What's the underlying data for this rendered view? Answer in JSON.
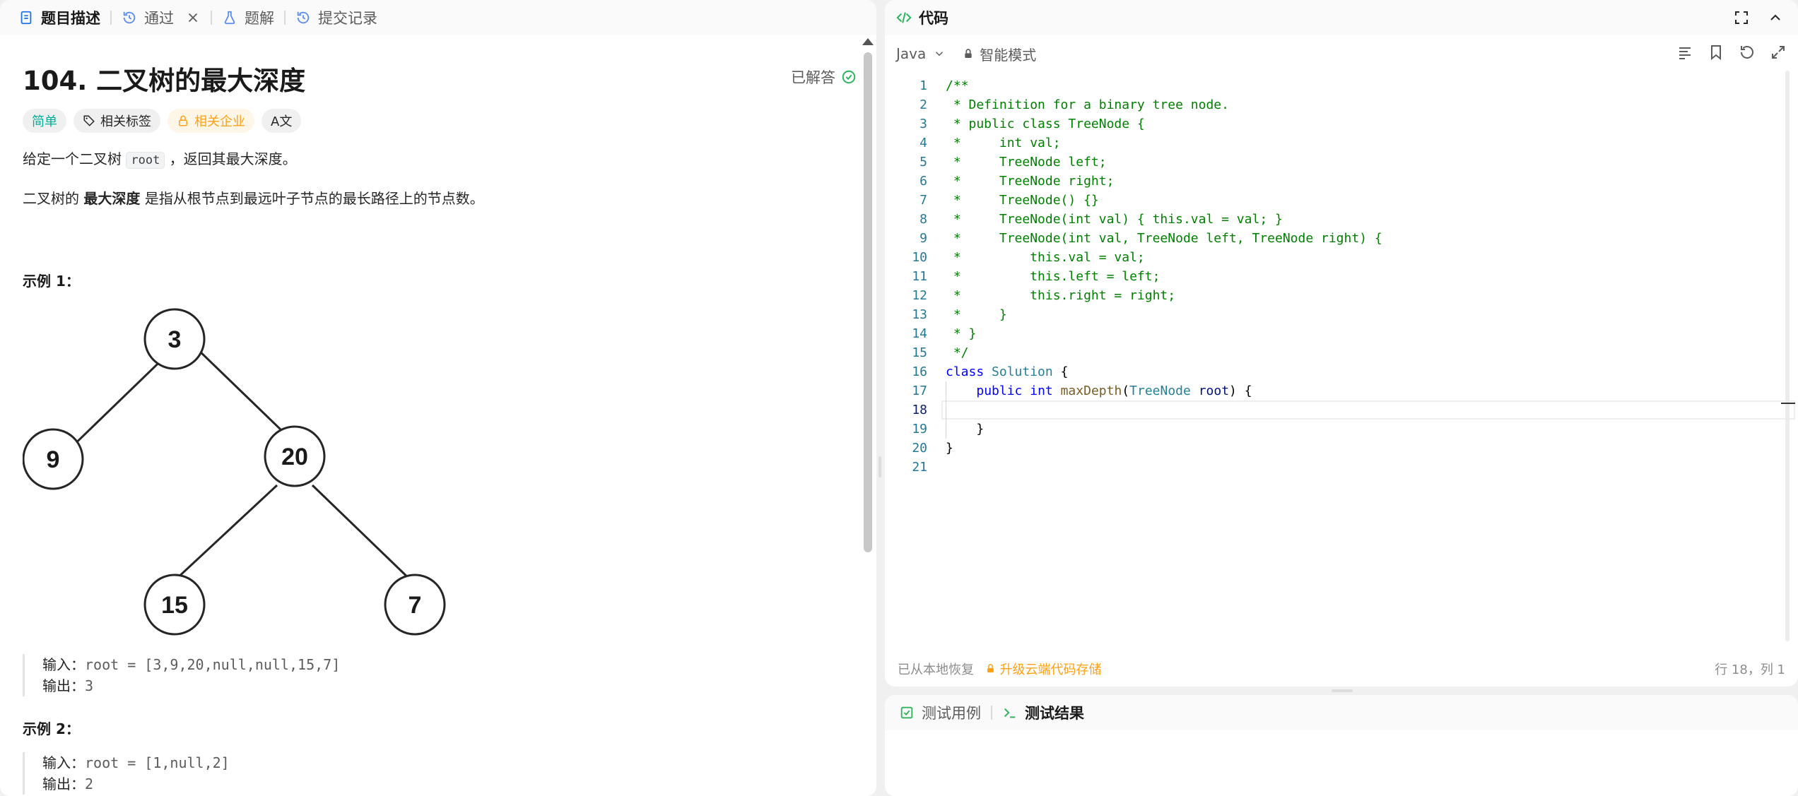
{
  "left_tabs": [
    {
      "label": "题目描述",
      "icon": "document-icon"
    },
    {
      "label": "通过",
      "icon": "history-icon"
    },
    {
      "label": "题解",
      "icon": "flask-icon"
    },
    {
      "label": "提交记录",
      "icon": "history-icon"
    }
  ],
  "problem": {
    "title": "104. 二叉树的最大深度",
    "solved_label": "已解答",
    "tags": {
      "difficulty": "简单",
      "related_topics": "相关标签",
      "companies": "相关企业",
      "translate": "A文"
    },
    "desc_line1_pre": "给定一个二叉树 ",
    "desc_line1_code": "root",
    "desc_line1_post": " ，返回其最大深度。",
    "desc_line2_pre": "二叉树的 ",
    "desc_line2_bold": "最大深度",
    "desc_line2_post": " 是指从根节点到最远叶子节点的最长路径上的节点数。",
    "example1_title": "示例 1：",
    "tree_nodes": [
      "3",
      "9",
      "20",
      "15",
      "7"
    ],
    "example1_input_label": "输入：",
    "example1_input": "root = [3,9,20,null,null,15,7]",
    "example1_output_label": "输出：",
    "example1_output": "3",
    "example2_title": "示例 2：",
    "example2_input_label": "输入：",
    "example2_input": "root = [1,null,2]",
    "example2_output_label": "输出：",
    "example2_output": "2"
  },
  "editor": {
    "tab_label": "代码",
    "language": "Java",
    "mode": "智能模式",
    "code_lines": [
      "/**",
      " * Definition for a binary tree node.",
      " * public class TreeNode {",
      " *     int val;",
      " *     TreeNode left;",
      " *     TreeNode right;",
      " *     TreeNode() {}",
      " *     TreeNode(int val) { this.val = val; }",
      " *     TreeNode(int val, TreeNode left, TreeNode right) {",
      " *         this.val = val;",
      " *         this.left = left;",
      " *         this.right = right;",
      " *     }",
      " * }",
      " */",
      "class Solution {",
      "    public int maxDepth(TreeNode root) {",
      "",
      "    }",
      "}",
      ""
    ],
    "line_numbers": [
      "1",
      "2",
      "3",
      "4",
      "5",
      "6",
      "7",
      "8",
      "9",
      "10",
      "11",
      "12",
      "13",
      "14",
      "15",
      "16",
      "17",
      "18",
      "19",
      "20",
      "21"
    ],
    "current_line": "18",
    "status_restored": "已从本地恢复",
    "status_upgrade": "升级云端代码存储",
    "status_position": "行 18，列 1"
  },
  "test_tabs": [
    {
      "label": "测试用例",
      "icon": "checkbox-icon"
    },
    {
      "label": "测试结果",
      "icon": "terminal-icon"
    }
  ]
}
